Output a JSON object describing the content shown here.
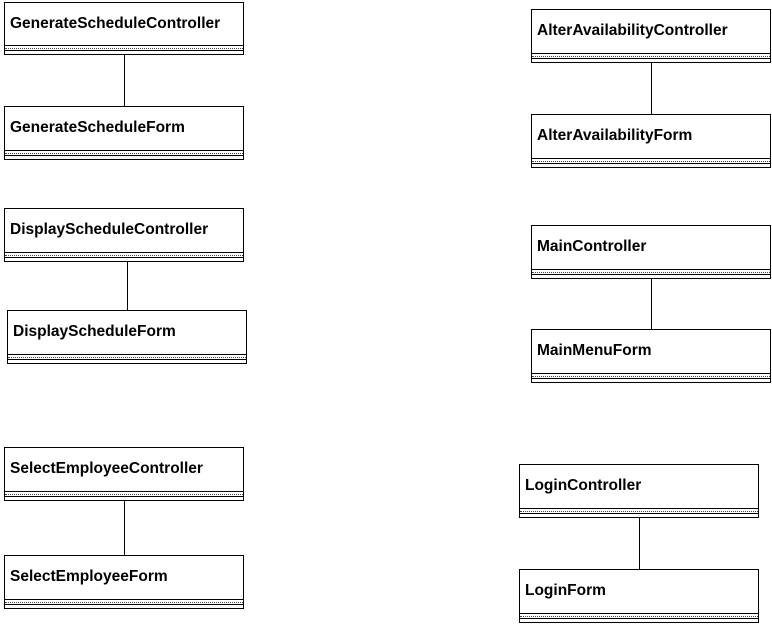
{
  "diagram": {
    "classes": {
      "generate_schedule_controller": "GenerateScheduleController",
      "generate_schedule_form": "GenerateScheduleForm",
      "display_schedule_controller": "DisplayScheduleController",
      "display_schedule_form": "DisplayScheduleForm",
      "select_employee_controller": "SelectEmployeeController",
      "select_employee_form": "SelectEmployeeForm",
      "alter_availability_controller": "AlterAvailabilityController",
      "alter_availability_form": "AlterAvailabilityForm",
      "main_controller": "MainController",
      "main_menu_form": "MainMenuForm",
      "login_controller": "LoginController",
      "login_form": "LoginForm"
    }
  }
}
